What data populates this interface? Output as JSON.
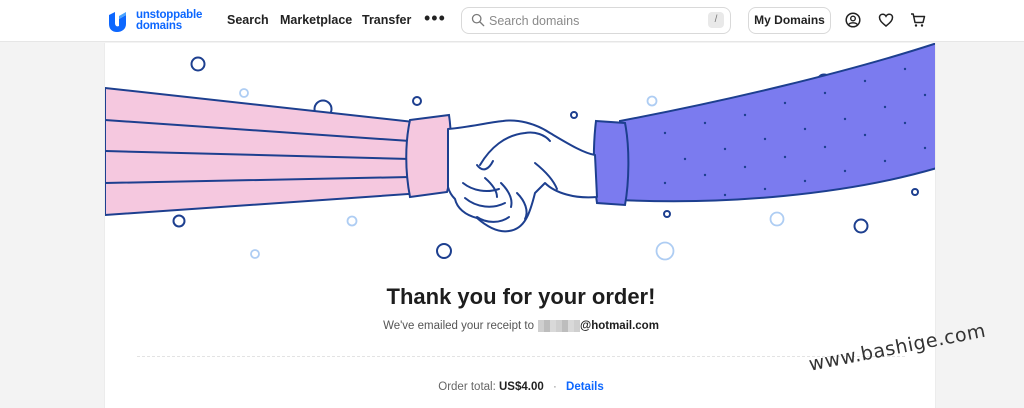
{
  "header": {
    "logo_line1": "unstoppable",
    "logo_line2": "domains",
    "nav": {
      "search": "Search",
      "marketplace": "Marketplace",
      "transfer": "Transfer",
      "more": "•••"
    },
    "search": {
      "placeholder": "Search domains",
      "shortcut": "/"
    },
    "my_domains": "My Domains",
    "icons": [
      "user-icon",
      "heart-icon",
      "cart-icon"
    ]
  },
  "confirmation": {
    "title": "Thank you for your order!",
    "email_prefix": "We've emailed your receipt to",
    "email_domain": "@hotmail.com",
    "order_total_label": "Order total:",
    "order_total_value": "US$4.00",
    "separator": "·",
    "details_link": "Details"
  },
  "colors": {
    "brand": "#0d67fe",
    "sleeve_left": "#f5c8df",
    "sleeve_right": "#7b7bef",
    "outline": "#1d3f8f"
  },
  "watermark": "www.bashige.com"
}
